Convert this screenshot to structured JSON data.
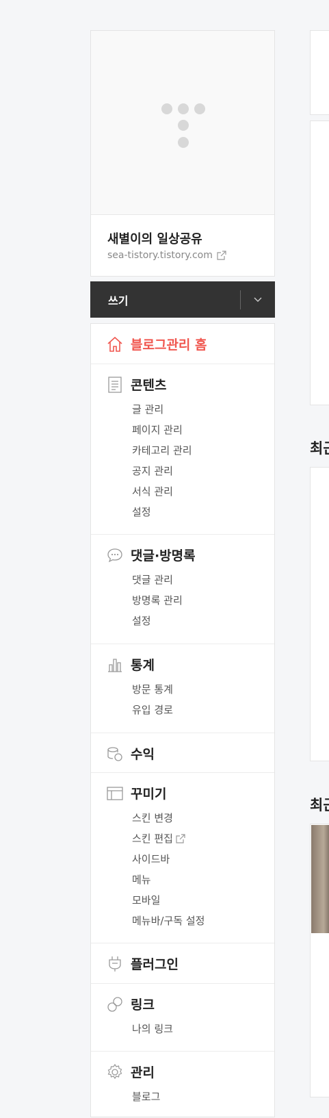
{
  "blog": {
    "title": "새별이의 일상공유",
    "url": "sea-tistory.tistory.com"
  },
  "write": {
    "label": "쓰기"
  },
  "menu": {
    "home": "블로그관리 홈",
    "contents": {
      "label": "콘텐츠",
      "items": [
        "글 관리",
        "페이지 관리",
        "카테고리 관리",
        "공지 관리",
        "서식 관리",
        "설정"
      ]
    },
    "comments": {
      "label": "댓글·방명록",
      "items": [
        "댓글 관리",
        "방명록 관리",
        "설정"
      ]
    },
    "stats": {
      "label": "통계",
      "items": [
        "방문 통계",
        "유입 경로"
      ]
    },
    "revenue": {
      "label": "수익"
    },
    "design": {
      "label": "꾸미기",
      "items": [
        "스킨 변경",
        "스킨 편집",
        "사이드바",
        "메뉴",
        "모바일",
        "메뉴바/구독 설정"
      ]
    },
    "plugin": {
      "label": "플러그인"
    },
    "link": {
      "label": "링크",
      "items": [
        "나의 링크"
      ]
    },
    "manage": {
      "label": "관리",
      "items": [
        "블로그"
      ]
    }
  },
  "right": {
    "heading1": "최근",
    "heading2": "최근"
  },
  "colors": {
    "accent": "#f0574f",
    "dark_button": "#333333"
  }
}
